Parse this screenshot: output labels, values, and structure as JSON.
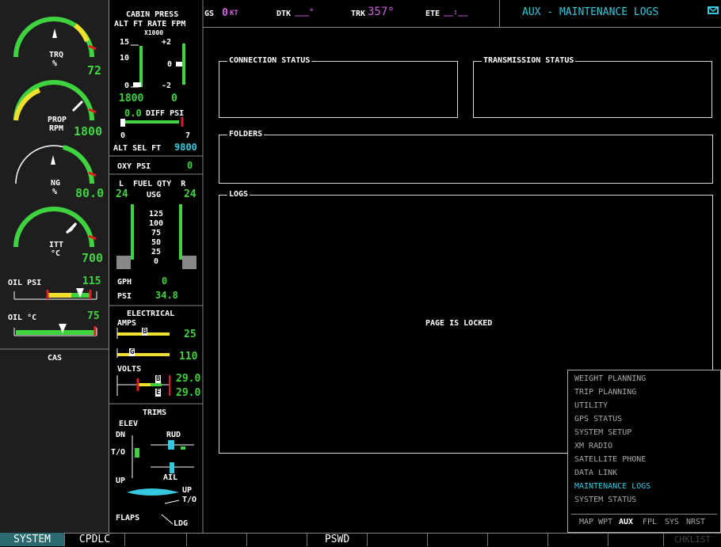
{
  "engine": {
    "trq": {
      "l1": "TRQ",
      "l2": "%",
      "value": "72",
      "fraction": 0.72
    },
    "prop": {
      "l1": "PROP",
      "l2": "RPM",
      "value": "1800",
      "fraction": 0.55
    },
    "ng": {
      "l1": "NG",
      "l2": "%",
      "value": "80.0",
      "fraction": 0.65
    },
    "itt": {
      "l1": "ITT",
      "l2": "°C",
      "value": "700",
      "fraction": 0.6
    },
    "oil_psi": {
      "label": "OIL PSI",
      "value": "115",
      "fraction": 0.7
    },
    "oil_c": {
      "label": "OIL °C",
      "value": "75",
      "fraction": 0.72
    },
    "cas_label": "CAS"
  },
  "cabin": {
    "title": "CABIN PRESS",
    "sub": "ALT FT RATE FPM",
    "x1000": "X1000",
    "alt_top": "15",
    "alt_mid": "10",
    "alt_bot": "0",
    "rate_top": "+2",
    "rate_mid": "0",
    "rate_bot": "-2",
    "alt_value": "1800",
    "rate_value": "0",
    "diff_value": "0.0",
    "diff_label": "DIFF PSI",
    "diff_min": "0",
    "diff_max": "7",
    "alt_sel_label": "ALT SEL FT",
    "alt_sel_value": "9800"
  },
  "oxy": {
    "label": "OXY PSI",
    "value": "0"
  },
  "fuel": {
    "header": "L  FUEL QTY  R",
    "left": "24",
    "usg": "USG",
    "right": "24",
    "scale": [
      "125",
      "100",
      "75",
      "50",
      "25",
      "0"
    ],
    "gph_label": "GPH",
    "gph_value": "0",
    "psi_label": "PSI",
    "psi_value": "34.8"
  },
  "electrical": {
    "title": "ELECTRICAL",
    "amps_label": "AMPS",
    "amps1": "25",
    "amps1_tag": "B",
    "amps2": "110",
    "amps2_tag": "G",
    "volts_label": "VOLTS",
    "volts1": "29.0",
    "volts1_tag": "B",
    "volts2": "29.0",
    "volts2_tag": "E"
  },
  "trims": {
    "title": "TRIMS",
    "elev": "ELEV",
    "dn": "DN",
    "to": "T/O",
    "up": "UP",
    "rud": "RUD",
    "ail": "AIL",
    "up2": "UP",
    "to2": "T/O",
    "flaps": "FLAPS",
    "ldg": "LDG"
  },
  "topbar": {
    "gs_label": "GS",
    "gs_value": "0",
    "gs_unit": "KT",
    "dtk_label": "DTK",
    "dtk_value": "___°",
    "trk_label": "TRK",
    "trk_value": "357°",
    "ete_label": "ETE",
    "ete_value": "__:__",
    "page_title": "AUX - MAINTENANCE LOGS"
  },
  "boxes": {
    "connection": "CONNECTION STATUS",
    "transmission": "TRANSMISSION STATUS",
    "folders": "FOLDERS",
    "logs": "LOGS",
    "locked": "PAGE IS LOCKED"
  },
  "menu": {
    "items": [
      "WEIGHT PLANNING",
      "TRIP PLANNING",
      "UTILITY",
      "GPS STATUS",
      "SYSTEM SETUP",
      "XM RADIO",
      "SATELLITE PHONE",
      "DATA LINK",
      "MAINTENANCE LOGS",
      "SYSTEM STATUS"
    ],
    "selected_index": 8,
    "groups": [
      "MAP",
      "WPT",
      "AUX",
      "FPL",
      "SYS",
      "NRST"
    ],
    "active_group": "AUX"
  },
  "softkeys": [
    "SYSTEM",
    "CPDLC",
    "",
    "",
    "",
    "PSWD",
    "",
    "",
    "",
    "",
    "",
    "CHKLIST"
  ],
  "colors": {
    "green": "#3fd33f",
    "cyan": "#35c8e0",
    "magenta": "#d060e0",
    "yellow": "#f0e030",
    "red": "#e02020",
    "softkey_bg": "#2a6a6e"
  }
}
